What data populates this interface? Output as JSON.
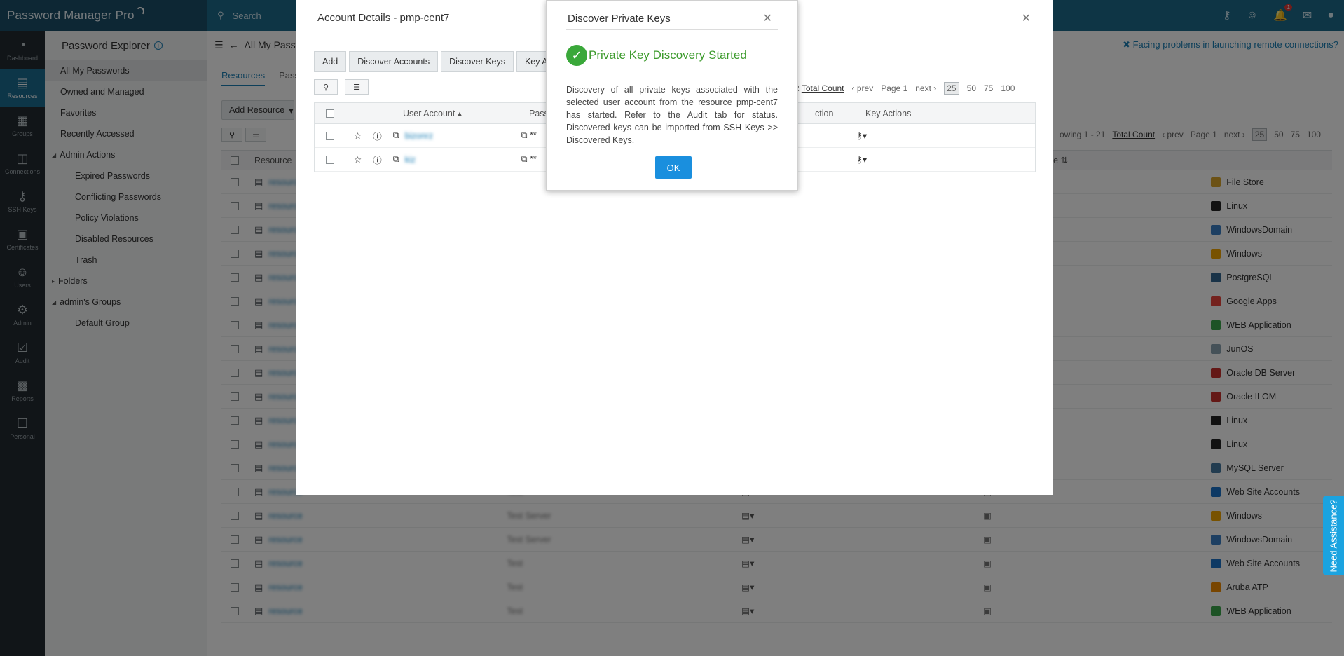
{
  "app": {
    "logo": "Password Manager Pro"
  },
  "topbar": {
    "search_placeholder": "Search",
    "notification_count": "1"
  },
  "leftnav": [
    {
      "label": "Dashboard",
      "icon": "dashboard-icon"
    },
    {
      "label": "Resources",
      "icon": "resources-icon"
    },
    {
      "label": "Groups",
      "icon": "groups-icon"
    },
    {
      "label": "Connections",
      "icon": "connections-icon"
    },
    {
      "label": "SSH Keys",
      "icon": "ssh-keys-icon"
    },
    {
      "label": "Certificates",
      "icon": "certificates-icon"
    },
    {
      "label": "Users",
      "icon": "users-icon"
    },
    {
      "label": "Admin",
      "icon": "admin-icon"
    },
    {
      "label": "Audit",
      "icon": "audit-icon"
    },
    {
      "label": "Reports",
      "icon": "reports-icon"
    },
    {
      "label": "Personal",
      "icon": "personal-icon"
    }
  ],
  "explorer": {
    "title": "Password Explorer",
    "items": [
      "All My Passwords",
      "Owned and Managed",
      "Favorites",
      "Recently Accessed"
    ],
    "admin_actions_label": "Admin Actions",
    "admin_actions": [
      "Expired Passwords",
      "Conflicting Passwords",
      "Policy Violations",
      "Disabled Resources",
      "Trash"
    ],
    "folders_label": "Folders",
    "groups_label": "admin's Groups",
    "groups": [
      "Default Group"
    ]
  },
  "main": {
    "title": "All My Passw",
    "facing_link": "Facing problems in launching remote connections?",
    "tabs": [
      "Resources",
      "Passw"
    ],
    "add_resource": "Add Resource",
    "pager": {
      "showing": "owing 1 - 21",
      "total": "Total Count",
      "prev": "prev",
      "page": "Page 1",
      "next": "next",
      "sizes": [
        "25",
        "50",
        "75",
        "100"
      ]
    },
    "columns": {
      "resource": "Resource",
      "type": "Type"
    },
    "rows": [
      {
        "desc": "",
        "type": "File Store",
        "color": "#d8a52a"
      },
      {
        "desc": "",
        "type": "Linux",
        "color": "#222222"
      },
      {
        "desc": "",
        "type": "WindowsDomain",
        "color": "#3a7fc4"
      },
      {
        "desc": "",
        "type": "Windows",
        "color": "#f0a400"
      },
      {
        "desc": "",
        "type": "PostgreSQL",
        "color": "#336791"
      },
      {
        "desc": "",
        "type": "Google Apps",
        "color": "#e8453c"
      },
      {
        "desc": "",
        "type": "WEB Application",
        "color": "#3aa64a"
      },
      {
        "desc": "",
        "type": "JunOS",
        "color": "#8aa2b0"
      },
      {
        "desc": "",
        "type": "Oracle DB Server",
        "color": "#c9302c"
      },
      {
        "desc": "",
        "type": "Oracle ILOM",
        "color": "#c9302c"
      },
      {
        "desc": "",
        "type": "Linux",
        "color": "#222222"
      },
      {
        "desc": "",
        "type": "Linux",
        "color": "#222222"
      },
      {
        "desc": "",
        "type": "MySQL Server",
        "color": "#4479a1"
      },
      {
        "desc": "Test",
        "type": "Web Site Accounts",
        "color": "#1a73c8"
      },
      {
        "desc": "Test Server",
        "type": "Windows",
        "color": "#f0a400"
      },
      {
        "desc": "Test Server",
        "type": "WindowsDomain",
        "color": "#3a7fc4"
      },
      {
        "desc": "Test",
        "type": "Web Site Accounts",
        "color": "#1a73c8"
      },
      {
        "desc": "Test",
        "type": "Aruba ATP",
        "color": "#f08a00"
      },
      {
        "desc": "Test",
        "type": "WEB Application",
        "color": "#3aa64a"
      }
    ]
  },
  "account_details": {
    "title": "Account Details - pmp-cent7",
    "buttons": [
      "Add",
      "Discover Accounts",
      "Discover Keys",
      "Key Acti"
    ],
    "pager": {
      "count": "2",
      "total": "Total Count",
      "prev": "prev",
      "page": "Page 1",
      "next": "next",
      "sizes": [
        "25",
        "50",
        "75",
        "100"
      ]
    },
    "columns": {
      "user_account": "User Account",
      "password": "Passw",
      "action": "ction",
      "key_actions": "Key Actions"
    }
  },
  "dialog": {
    "title": "Discover Private Keys",
    "status": "Private Key Discovery Started",
    "message": "Discovery of all private keys associated with the selected user account from the resource pmp-cent7 has started. Refer to the Audit tab for status. Discovered keys can be imported from SSH Keys >> Discovered Keys.",
    "ok": "OK"
  },
  "assist": "Need Assistance?"
}
